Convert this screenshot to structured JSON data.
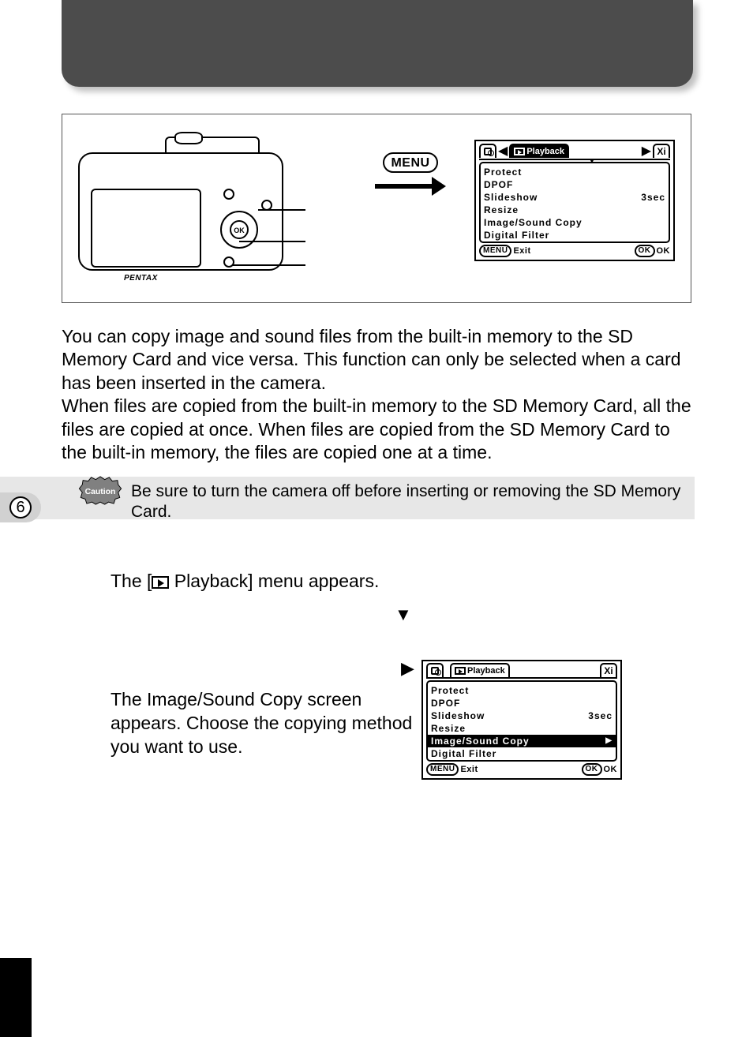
{
  "page_tab_number": "6",
  "menu_label": "MENU",
  "camera_brand": "PENTAX",
  "camera_ok": "OK",
  "body_para1": "You can copy image and sound files from the built-in memory to the SD Memory Card and vice versa. This function can only be selected when a card has been inserted in the camera.",
  "body_para2": "When files are copied from the built-in memory to the SD Memory Card, all the files are copied at once. When files are copied from the SD Memory Card to the built-in memory, the files are copied one at a time.",
  "caution_label": "Caution",
  "caution_text": "Be sure to turn the camera off before inserting or removing the SD Memory Card.",
  "instr1_pre": "The [",
  "instr1_post": " Playback] menu appears.",
  "instr2": "The Image/Sound Copy screen appears. Choose the copying method you want to use.",
  "lcd": {
    "play_tab": "Playback",
    "items": [
      {
        "label": "Protect",
        "value": ""
      },
      {
        "label": "DPOF",
        "value": ""
      },
      {
        "label": "Slideshow",
        "value": "3sec"
      },
      {
        "label": "Resize",
        "value": ""
      },
      {
        "label": "Image/Sound Copy",
        "value": ""
      },
      {
        "label": "Digital Filter",
        "value": ""
      }
    ],
    "exit": "Exit",
    "ok": "OK",
    "menu_sm": "MENU"
  }
}
